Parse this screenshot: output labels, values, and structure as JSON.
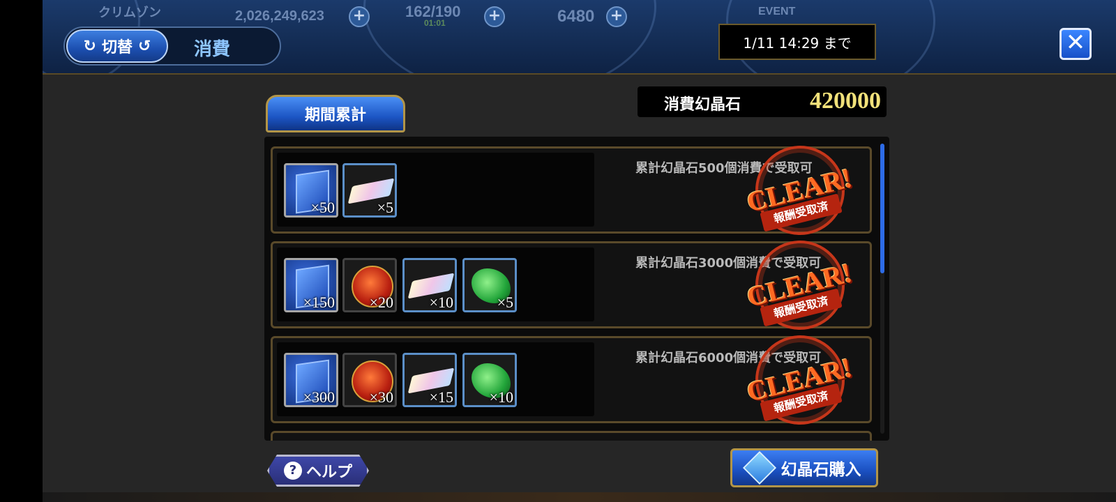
{
  "hud": {
    "player_name": "クリムゾン",
    "gold": "2,026,249,623",
    "stamina": "162/190",
    "stamina_timer": "01:01",
    "crystals": "6480",
    "event_label": "EVENT"
  },
  "header": {
    "switch_label": "切替",
    "mode_label": "消費",
    "deadline": "1/11 14:29 まで",
    "close_icon": "close-x-icon"
  },
  "tab": {
    "label": "期間累計"
  },
  "total": {
    "label": "消費幻晶石",
    "value": "420000"
  },
  "rewards": [
    {
      "condition": "累計幻晶石500個消費で受取可",
      "status": "CLEAR!",
      "status_sub": "報酬受取済",
      "items": [
        {
          "icon": "crystal-ticket-icon",
          "qty": "×50"
        },
        {
          "icon": "rainbow-ingot-icon",
          "qty": "×5"
        }
      ]
    },
    {
      "condition": "累計幻晶石3000個消費で受取可",
      "status": "CLEAR!",
      "status_sub": "報酬受取済",
      "items": [
        {
          "icon": "crystal-ticket-icon",
          "qty": "×150"
        },
        {
          "icon": "2024-medal-icon",
          "qty": "×20"
        },
        {
          "icon": "rainbow-ingot-icon",
          "qty": "×10"
        },
        {
          "icon": "green-leaf-icon",
          "qty": "×5"
        }
      ]
    },
    {
      "condition": "累計幻晶石6000個消費で受取可",
      "status": "CLEAR!",
      "status_sub": "報酬受取済",
      "items": [
        {
          "icon": "crystal-ticket-icon",
          "qty": "×300"
        },
        {
          "icon": "2024-medal-icon",
          "qty": "×30"
        },
        {
          "icon": "rainbow-ingot-icon",
          "qty": "×15"
        },
        {
          "icon": "green-leaf-icon",
          "qty": "×10"
        }
      ]
    }
  ],
  "footer": {
    "help_label": "ヘルプ",
    "buy_label": "幻晶石購入"
  },
  "colors": {
    "accent_blue": "#1c55c4",
    "gold_border": "#b29548",
    "clear_red": "#c6361a",
    "total_yellow": "#f2e27a"
  }
}
